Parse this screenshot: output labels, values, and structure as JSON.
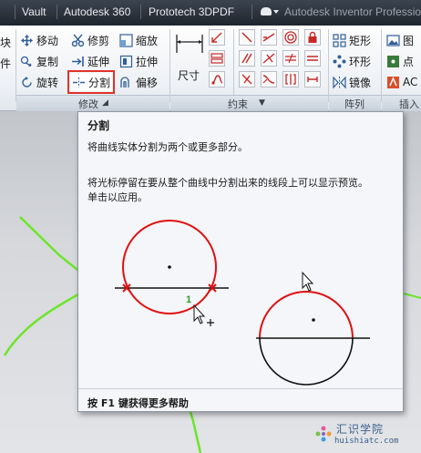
{
  "menubar": {
    "items": [
      "Vault",
      "Autodesk 360",
      "Prototech 3DPDF"
    ],
    "app_title": "Autodesk Inventor Professional"
  },
  "ribbon": {
    "left_col": [
      "块",
      "件"
    ],
    "modify": {
      "move": "移动",
      "trim": "修剪",
      "scale": "缩放",
      "copy": "复制",
      "extend": "延伸",
      "stretch": "拉伸",
      "rotate": "旋转",
      "split": "分割",
      "offset": "偏移"
    },
    "dimension": "尺寸",
    "pattern": {
      "rect": "矩形",
      "circ": "环形",
      "mirror": "镜像"
    },
    "insert_col": [
      "图",
      "点",
      "AC"
    ],
    "panels": {
      "modify": "修改",
      "constrain": "约束",
      "pattern": "阵列",
      "insert": "插入"
    }
  },
  "tooltip": {
    "title": "分割",
    "description": "将曲线实体分割为两个或更多部分。",
    "detail_line1": "将光标停留在要从整个曲线中分割出来的线段上可以显示预览。",
    "detail_line2": "单击以应用。",
    "point_label": "1",
    "help": "按 F1 键获得更多帮助"
  },
  "watermark": {
    "name": "汇识学院",
    "url": "huishiatc.com"
  },
  "colors": {
    "accent": "#e0322b",
    "curve": "#e01010",
    "sketch": "#6de52a"
  }
}
